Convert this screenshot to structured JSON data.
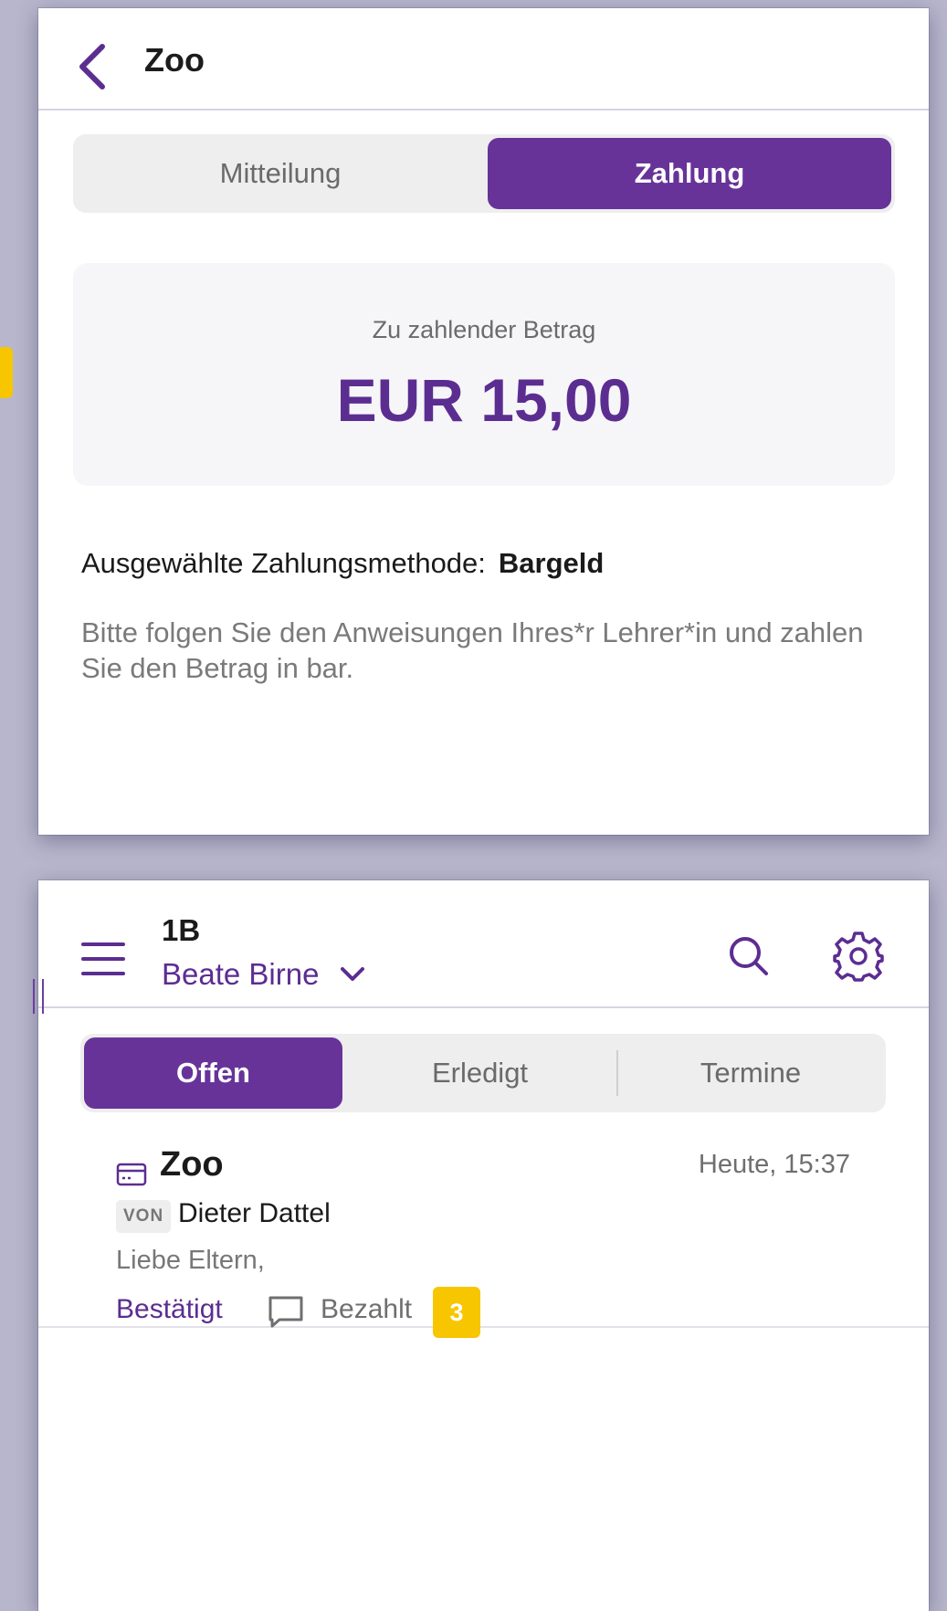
{
  "detail": {
    "title": "Zoo",
    "tabs": {
      "message": "Mitteilung",
      "payment": "Zahlung"
    },
    "amount_label": "Zu zahlender Betrag",
    "amount_value": "EUR 15,00",
    "method_label": "Ausgewählte Zahlungsmethode:",
    "method_value": "Bargeld",
    "hint": "Bitte folgen Sie den Anweisungen Ihres*r Lehrer*in und zahlen Sie den Betrag in bar."
  },
  "list": {
    "class_name": "1B",
    "user": "Beate Birne",
    "tabs": {
      "open": "Offen",
      "done": "Erledigt",
      "dates": "Termine"
    },
    "item": {
      "title": "Zoo",
      "time": "Heute, 15:37",
      "from_badge": "VON",
      "sender": "Dieter Dattel",
      "preview": "Liebe Eltern,",
      "status_confirmed": "Bestätigt",
      "status_paid": "Bezahlt",
      "count": "3"
    }
  },
  "colors": {
    "accent": "#673399",
    "accent_text": "#5c2d91",
    "badge": "#f7c600",
    "background": "#b7b6cc"
  },
  "icons": {
    "back": "chevron-left-icon",
    "menu": "hamburger-menu-icon",
    "dropdown": "chevron-down-icon",
    "search": "search-icon",
    "settings": "gear-icon",
    "item_type": "credit-card-icon",
    "comment": "comment-icon"
  }
}
